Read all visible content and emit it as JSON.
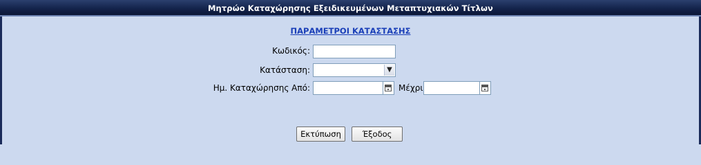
{
  "window": {
    "title": "Μητρώο Καταχώρησης Εξειδικευμένων Μεταπτυχιακών Τίτλων"
  },
  "section": {
    "link_label": "ΠΑΡΑΜΕΤΡΟΙ ΚΑΤΑΣΤΑΣΗΣ"
  },
  "form": {
    "code_label": "Κωδικός:",
    "code_value": "",
    "status_label": "Κατάσταση:",
    "status_value": "",
    "date_from_label": "Ημ. Καταχώρησης Από:",
    "date_from_value": "",
    "date_to_label": "Μέχρι:",
    "date_to_value": ""
  },
  "buttons": {
    "print_label": "Εκτύπωση",
    "exit_label": "Έξοδος"
  },
  "icons": {
    "dropdown": "chevron-down-icon",
    "calendar": "calendar-icon"
  }
}
